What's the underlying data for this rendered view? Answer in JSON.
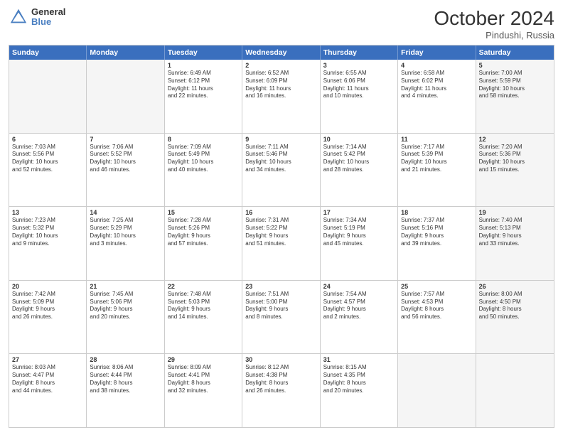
{
  "logo": {
    "general": "General",
    "blue": "Blue"
  },
  "title": "October 2024",
  "subtitle": "Pindushi, Russia",
  "header_days": [
    "Sunday",
    "Monday",
    "Tuesday",
    "Wednesday",
    "Thursday",
    "Friday",
    "Saturday"
  ],
  "weeks": [
    [
      {
        "day": "",
        "info": "",
        "shaded": true
      },
      {
        "day": "",
        "info": "",
        "shaded": true
      },
      {
        "day": "1",
        "info": "Sunrise: 6:49 AM\nSunset: 6:12 PM\nDaylight: 11 hours\nand 22 minutes."
      },
      {
        "day": "2",
        "info": "Sunrise: 6:52 AM\nSunset: 6:09 PM\nDaylight: 11 hours\nand 16 minutes."
      },
      {
        "day": "3",
        "info": "Sunrise: 6:55 AM\nSunset: 6:06 PM\nDaylight: 11 hours\nand 10 minutes."
      },
      {
        "day": "4",
        "info": "Sunrise: 6:58 AM\nSunset: 6:02 PM\nDaylight: 11 hours\nand 4 minutes."
      },
      {
        "day": "5",
        "info": "Sunrise: 7:00 AM\nSunset: 5:59 PM\nDaylight: 10 hours\nand 58 minutes.",
        "shaded": true
      }
    ],
    [
      {
        "day": "6",
        "info": "Sunrise: 7:03 AM\nSunset: 5:56 PM\nDaylight: 10 hours\nand 52 minutes."
      },
      {
        "day": "7",
        "info": "Sunrise: 7:06 AM\nSunset: 5:52 PM\nDaylight: 10 hours\nand 46 minutes."
      },
      {
        "day": "8",
        "info": "Sunrise: 7:09 AM\nSunset: 5:49 PM\nDaylight: 10 hours\nand 40 minutes."
      },
      {
        "day": "9",
        "info": "Sunrise: 7:11 AM\nSunset: 5:46 PM\nDaylight: 10 hours\nand 34 minutes."
      },
      {
        "day": "10",
        "info": "Sunrise: 7:14 AM\nSunset: 5:42 PM\nDaylight: 10 hours\nand 28 minutes."
      },
      {
        "day": "11",
        "info": "Sunrise: 7:17 AM\nSunset: 5:39 PM\nDaylight: 10 hours\nand 21 minutes."
      },
      {
        "day": "12",
        "info": "Sunrise: 7:20 AM\nSunset: 5:36 PM\nDaylight: 10 hours\nand 15 minutes.",
        "shaded": true
      }
    ],
    [
      {
        "day": "13",
        "info": "Sunrise: 7:23 AM\nSunset: 5:32 PM\nDaylight: 10 hours\nand 9 minutes."
      },
      {
        "day": "14",
        "info": "Sunrise: 7:25 AM\nSunset: 5:29 PM\nDaylight: 10 hours\nand 3 minutes."
      },
      {
        "day": "15",
        "info": "Sunrise: 7:28 AM\nSunset: 5:26 PM\nDaylight: 9 hours\nand 57 minutes."
      },
      {
        "day": "16",
        "info": "Sunrise: 7:31 AM\nSunset: 5:22 PM\nDaylight: 9 hours\nand 51 minutes."
      },
      {
        "day": "17",
        "info": "Sunrise: 7:34 AM\nSunset: 5:19 PM\nDaylight: 9 hours\nand 45 minutes."
      },
      {
        "day": "18",
        "info": "Sunrise: 7:37 AM\nSunset: 5:16 PM\nDaylight: 9 hours\nand 39 minutes."
      },
      {
        "day": "19",
        "info": "Sunrise: 7:40 AM\nSunset: 5:13 PM\nDaylight: 9 hours\nand 33 minutes.",
        "shaded": true
      }
    ],
    [
      {
        "day": "20",
        "info": "Sunrise: 7:42 AM\nSunset: 5:09 PM\nDaylight: 9 hours\nand 26 minutes."
      },
      {
        "day": "21",
        "info": "Sunrise: 7:45 AM\nSunset: 5:06 PM\nDaylight: 9 hours\nand 20 minutes."
      },
      {
        "day": "22",
        "info": "Sunrise: 7:48 AM\nSunset: 5:03 PM\nDaylight: 9 hours\nand 14 minutes."
      },
      {
        "day": "23",
        "info": "Sunrise: 7:51 AM\nSunset: 5:00 PM\nDaylight: 9 hours\nand 8 minutes."
      },
      {
        "day": "24",
        "info": "Sunrise: 7:54 AM\nSunset: 4:57 PM\nDaylight: 9 hours\nand 2 minutes."
      },
      {
        "day": "25",
        "info": "Sunrise: 7:57 AM\nSunset: 4:53 PM\nDaylight: 8 hours\nand 56 minutes."
      },
      {
        "day": "26",
        "info": "Sunrise: 8:00 AM\nSunset: 4:50 PM\nDaylight: 8 hours\nand 50 minutes.",
        "shaded": true
      }
    ],
    [
      {
        "day": "27",
        "info": "Sunrise: 8:03 AM\nSunset: 4:47 PM\nDaylight: 8 hours\nand 44 minutes."
      },
      {
        "day": "28",
        "info": "Sunrise: 8:06 AM\nSunset: 4:44 PM\nDaylight: 8 hours\nand 38 minutes."
      },
      {
        "day": "29",
        "info": "Sunrise: 8:09 AM\nSunset: 4:41 PM\nDaylight: 8 hours\nand 32 minutes."
      },
      {
        "day": "30",
        "info": "Sunrise: 8:12 AM\nSunset: 4:38 PM\nDaylight: 8 hours\nand 26 minutes."
      },
      {
        "day": "31",
        "info": "Sunrise: 8:15 AM\nSunset: 4:35 PM\nDaylight: 8 hours\nand 20 minutes."
      },
      {
        "day": "",
        "info": "",
        "shaded": true
      },
      {
        "day": "",
        "info": "",
        "shaded": true
      }
    ]
  ]
}
